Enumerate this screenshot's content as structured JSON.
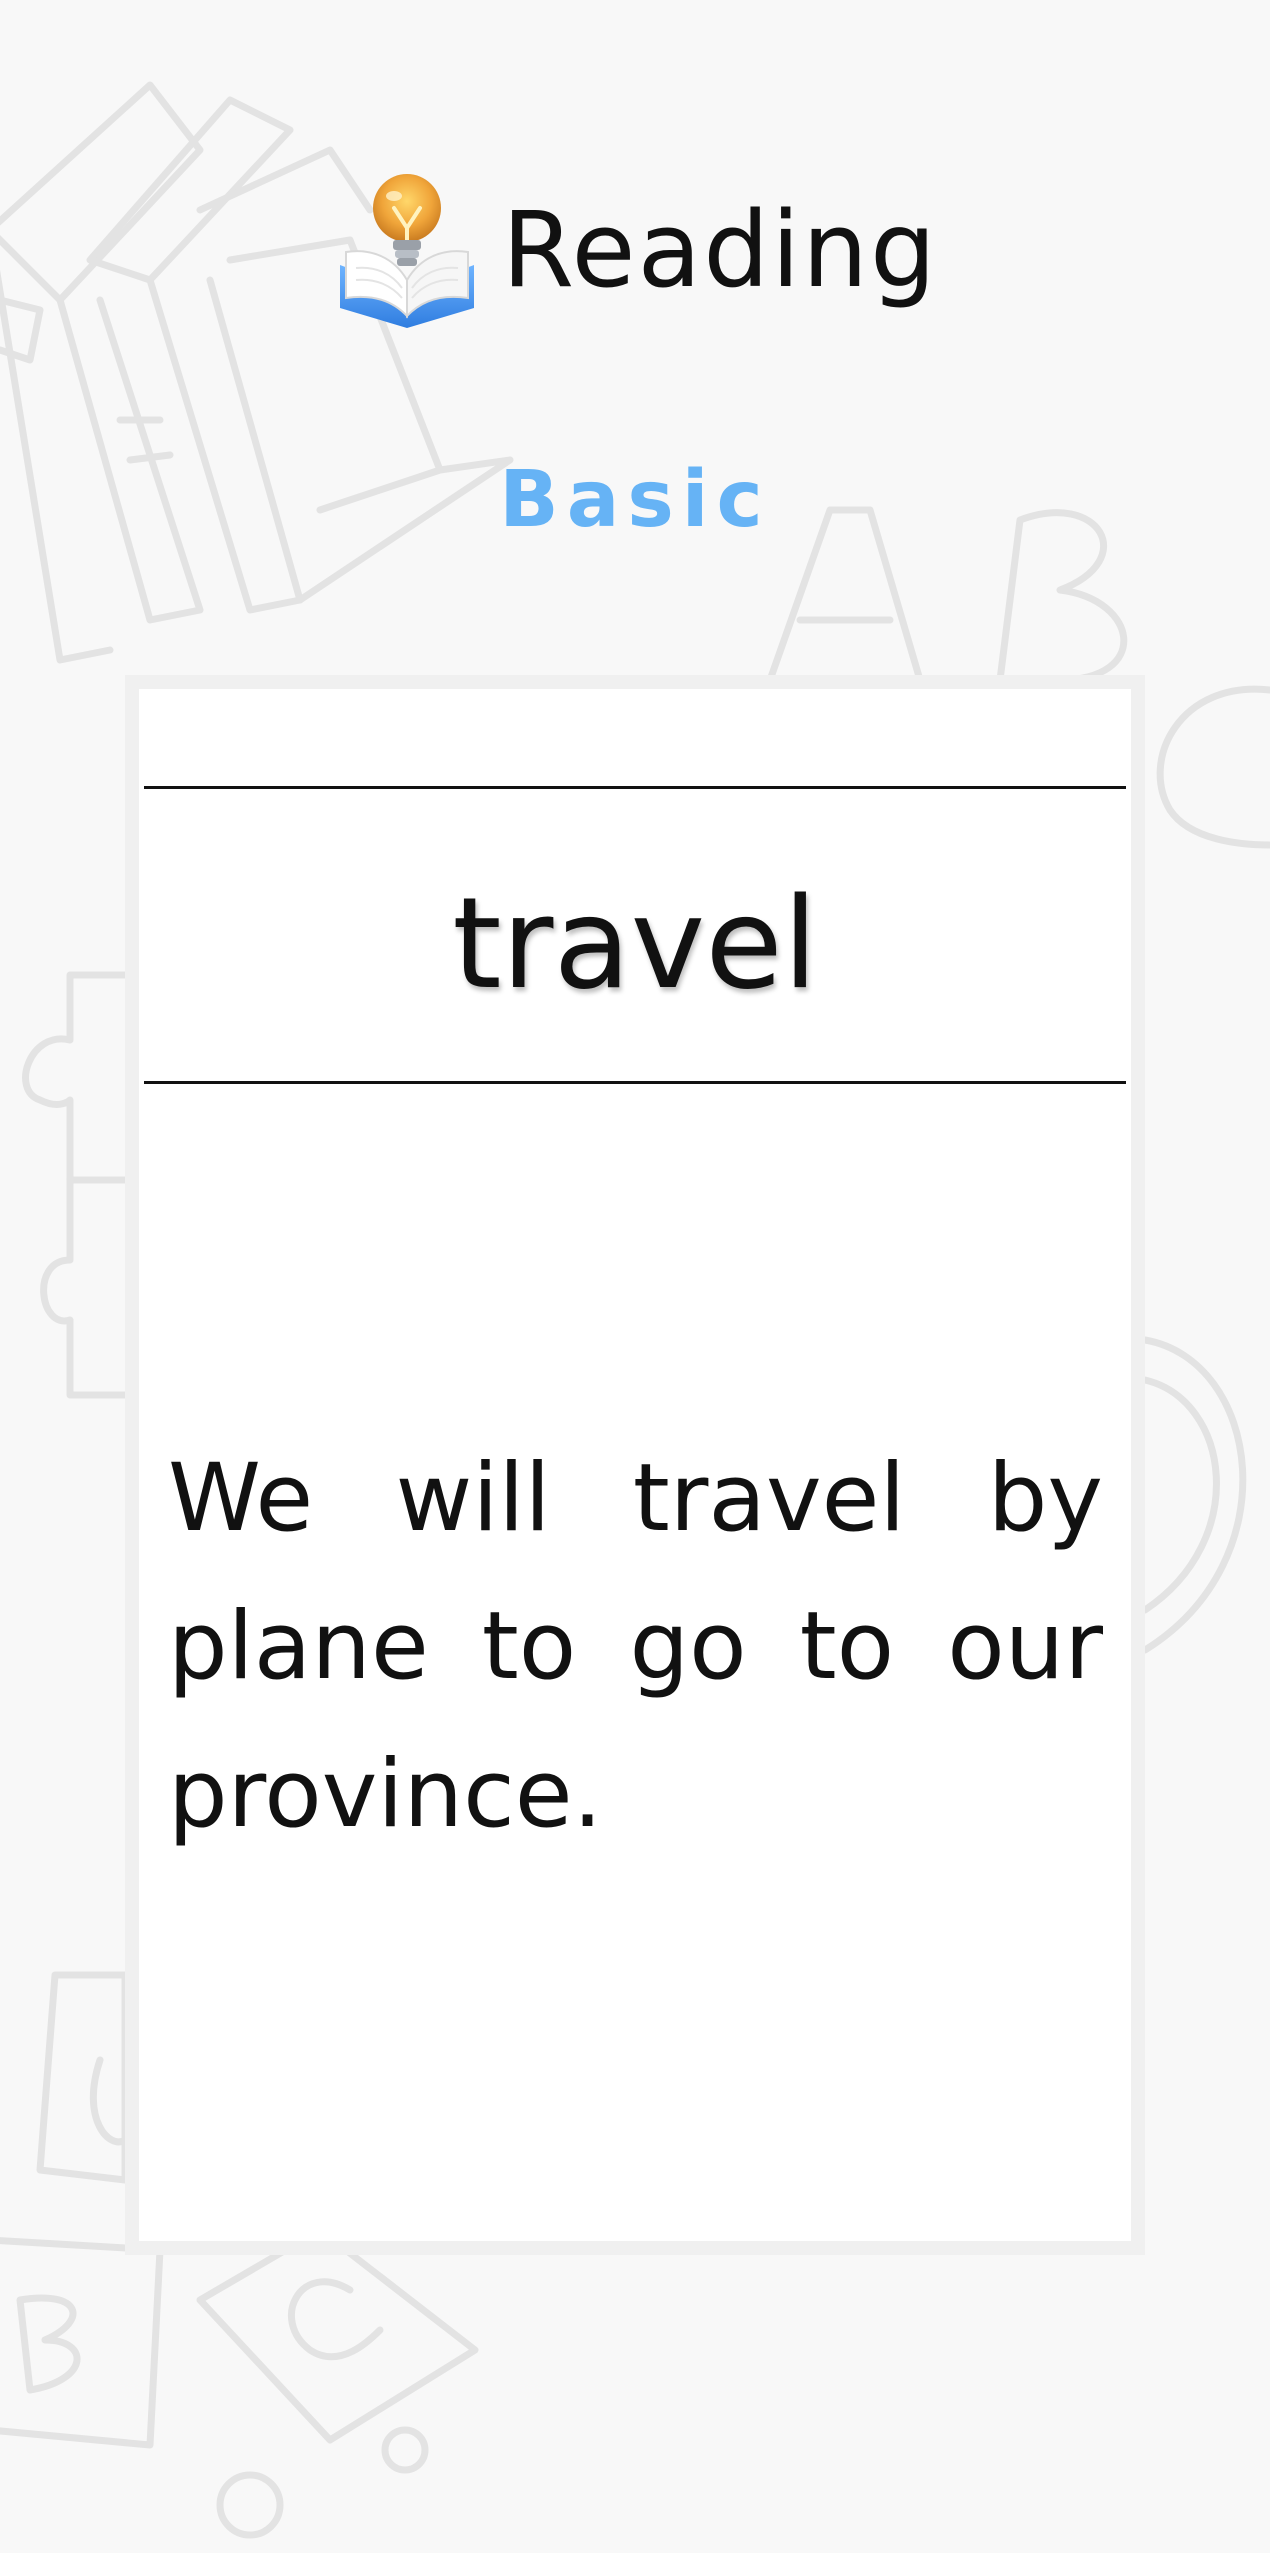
{
  "header": {
    "logo_icon": "book-lightbulb-icon",
    "title": "Reading"
  },
  "level": {
    "label": "Basic",
    "color": "#66b3f5"
  },
  "card": {
    "word": "travel",
    "sentence": "We will travel by plane to go to our province."
  },
  "background": {
    "decorations": [
      "books-doodle",
      "letter-a-doodle",
      "letter-b-doodle",
      "letter-c-doodle",
      "puzzle-doodle",
      "abc-blocks-doodle"
    ]
  }
}
